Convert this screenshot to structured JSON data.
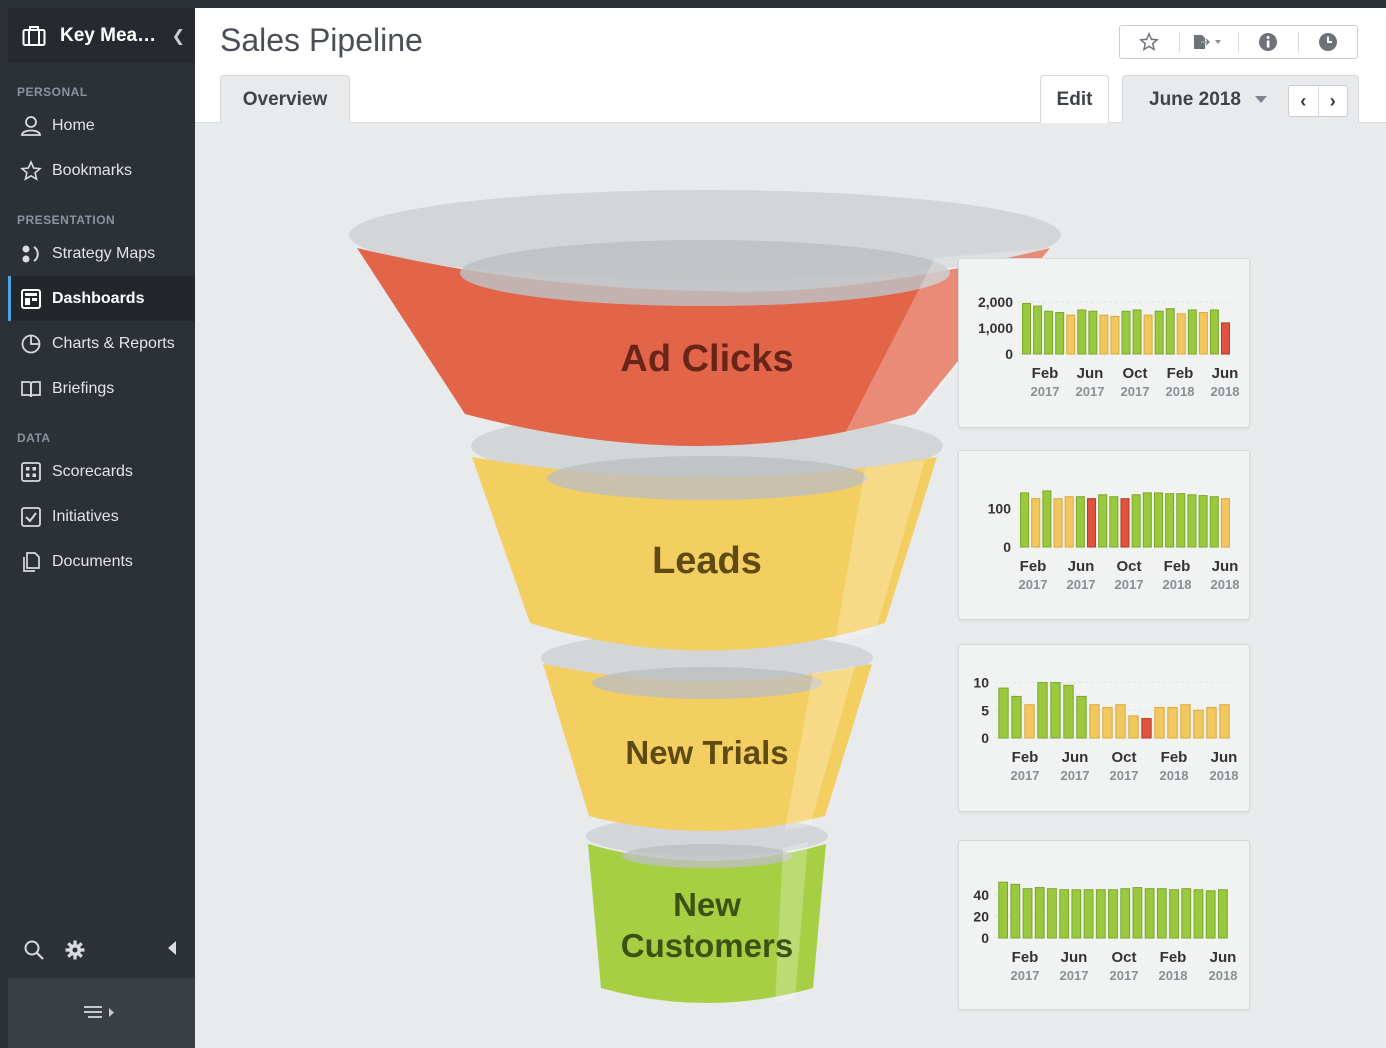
{
  "sidebar": {
    "brand": "Key Mea…",
    "sections": {
      "personal": "PERSONAL",
      "presentation": "PRESENTATION",
      "data": "DATA"
    },
    "items": {
      "home": "Home",
      "bookmarks": "Bookmarks",
      "strategy_maps": "Strategy Maps",
      "dashboards": "Dashboards",
      "charts_reports": "Charts & Reports",
      "briefings": "Briefings",
      "scorecards": "Scorecards",
      "initiatives": "Initiatives",
      "documents": "Documents"
    },
    "active_item": "Dashboards"
  },
  "header": {
    "title": "Sales Pipeline",
    "tab_overview": "Overview",
    "edit": "Edit",
    "period": "June 2018",
    "toolbar_icons": [
      "star-icon",
      "export-icon",
      "info-icon",
      "clock-icon"
    ]
  },
  "funnel": {
    "stages": [
      {
        "label": "Ad Clicks",
        "color": "#e2654a",
        "text_color": "#6a2418"
      },
      {
        "label": "Leads",
        "color": "#f3ce61",
        "text_color": "#5e4a12"
      },
      {
        "label": "New Trials",
        "color": "#f3ce61",
        "text_color": "#5e4a12"
      },
      {
        "label": "New Customers",
        "label_lines": [
          "New",
          "Customers"
        ],
        "color": "#a6cf44",
        "text_color": "#3c5213"
      }
    ]
  },
  "colors": {
    "green": "#9ac93f",
    "yellow": "#f3c760",
    "red": "#e0533f"
  },
  "chart_data": [
    {
      "type": "bar",
      "name": "Ad Clicks",
      "yticks": [
        "2,000",
        "1,000",
        "0"
      ],
      "ylim": [
        0,
        2200
      ],
      "tick_values": [
        2000,
        1000,
        0
      ],
      "xticks": [
        {
          "m": "Feb",
          "y": "2017"
        },
        {
          "m": "Jun",
          "y": "2017"
        },
        {
          "m": "Oct",
          "y": "2017"
        },
        {
          "m": "Feb",
          "y": "2018"
        },
        {
          "m": "Jun",
          "y": "2018"
        }
      ],
      "values": [
        1950,
        1850,
        1650,
        1600,
        1500,
        1700,
        1650,
        1500,
        1450,
        1650,
        1700,
        1500,
        1650,
        1750,
        1550,
        1700,
        1600,
        1700,
        1200
      ],
      "status": [
        "g",
        "g",
        "g",
        "g",
        "y",
        "g",
        "g",
        "y",
        "y",
        "g",
        "g",
        "y",
        "g",
        "g",
        "y",
        "g",
        "y",
        "g",
        "r"
      ]
    },
    {
      "type": "bar",
      "name": "Leads",
      "yticks": [
        "100",
        "0"
      ],
      "ylim": [
        0,
        150
      ],
      "tick_values": [
        100,
        0
      ],
      "xticks": [
        {
          "m": "Feb",
          "y": "2017"
        },
        {
          "m": "Jun",
          "y": "2017"
        },
        {
          "m": "Oct",
          "y": "2017"
        },
        {
          "m": "Feb",
          "y": "2018"
        },
        {
          "m": "Jun",
          "y": "2018"
        }
      ],
      "values": [
        140,
        125,
        145,
        125,
        130,
        130,
        125,
        135,
        130,
        125,
        135,
        140,
        140,
        138,
        138,
        135,
        133,
        130,
        125
      ],
      "status": [
        "g",
        "y",
        "g",
        "y",
        "y",
        "g",
        "r",
        "g",
        "g",
        "r",
        "g",
        "g",
        "g",
        "g",
        "g",
        "g",
        "g",
        "g",
        "y"
      ]
    },
    {
      "type": "bar",
      "name": "New Trials",
      "yticks": [
        "10",
        "5",
        "0"
      ],
      "ylim": [
        0,
        11
      ],
      "tick_values": [
        10,
        5,
        0
      ],
      "xticks": [
        {
          "m": "Feb",
          "y": "2017"
        },
        {
          "m": "Jun",
          "y": "2017"
        },
        {
          "m": "Oct",
          "y": "2017"
        },
        {
          "m": "Feb",
          "y": "2018"
        },
        {
          "m": "Jun",
          "y": "2018"
        }
      ],
      "values": [
        9,
        7.5,
        6,
        10,
        10,
        9.5,
        7.5,
        6,
        5.5,
        6,
        4,
        3.5,
        5.5,
        5.5,
        6,
        5,
        5.5,
        6
      ],
      "status": [
        "g",
        "g",
        "y",
        "g",
        "g",
        "g",
        "g",
        "y",
        "y",
        "y",
        "y",
        "r",
        "y",
        "y",
        "y",
        "y",
        "y",
        "y"
      ]
    },
    {
      "type": "bar",
      "name": "New Customers",
      "yticks": [
        "40",
        "20",
        "0"
      ],
      "ylim": [
        0,
        55
      ],
      "tick_values": [
        40,
        20,
        0
      ],
      "xticks": [
        {
          "m": "Feb",
          "y": "2017"
        },
        {
          "m": "Jun",
          "y": "2017"
        },
        {
          "m": "Oct",
          "y": "2017"
        },
        {
          "m": "Feb",
          "y": "2018"
        },
        {
          "m": "Jun",
          "y": "2018"
        }
      ],
      "values": [
        52,
        50,
        46,
        47,
        46,
        45,
        45,
        45,
        45,
        45,
        46,
        47,
        46,
        46,
        45,
        46,
        45,
        44,
        45
      ],
      "status": [
        "g",
        "g",
        "g",
        "g",
        "g",
        "g",
        "g",
        "g",
        "g",
        "g",
        "g",
        "g",
        "g",
        "g",
        "g",
        "g",
        "g",
        "g",
        "g"
      ]
    }
  ]
}
